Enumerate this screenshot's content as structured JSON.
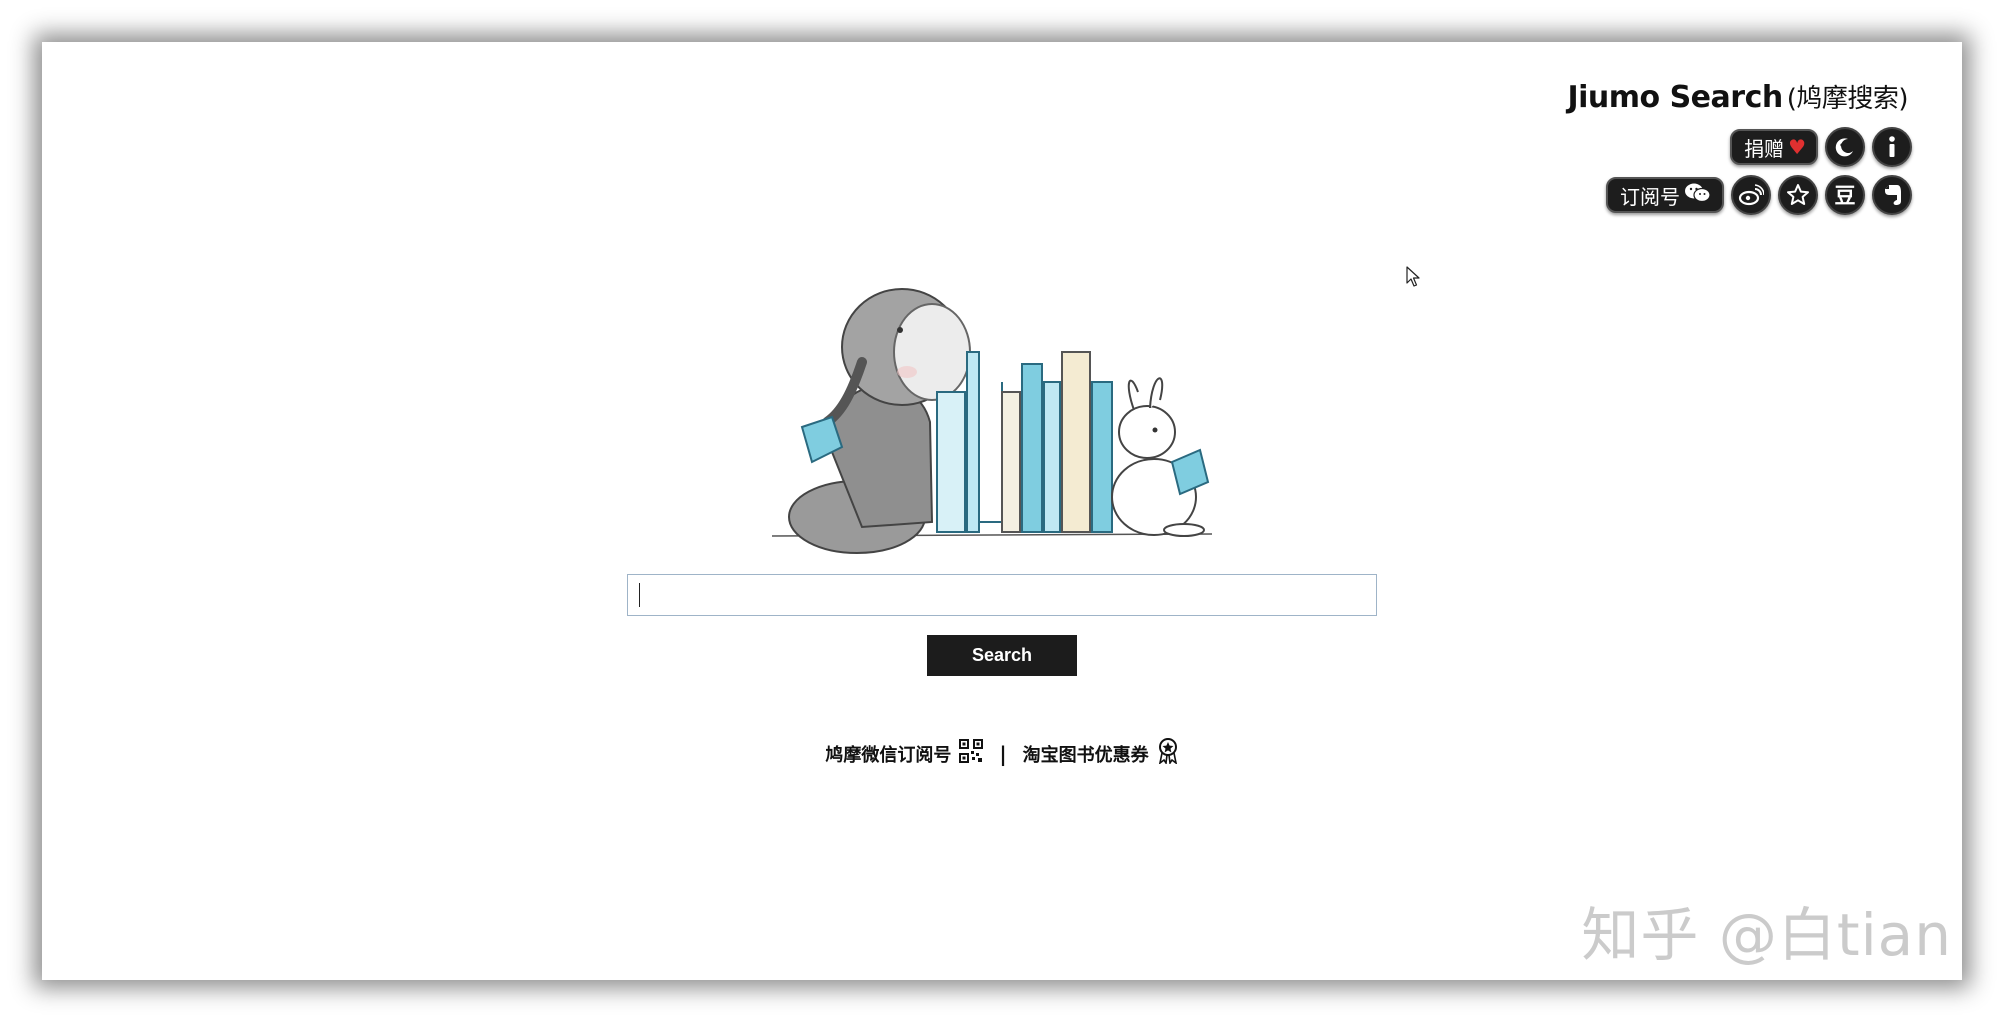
{
  "brand": {
    "title": "Jiumo Search",
    "subtitle": "(鸠摩搜索)"
  },
  "header_buttons": {
    "donate_label": "捐赠",
    "subscribe_label": "订阅号",
    "douban_label": "豆"
  },
  "search": {
    "placeholder": "",
    "value": "",
    "button_label": "Search"
  },
  "links": {
    "wechat_label": "鸠摩微信订阅号",
    "separator": "|",
    "taobao_label": "淘宝图书优惠券"
  },
  "watermark": "知乎 @白tian",
  "colors": {
    "button_bg": "#1c1c1c",
    "heart": "#e03030",
    "input_border": "#9fb4c8",
    "book_blue": "#7fcde0"
  },
  "icons": {
    "donate": "heart-icon",
    "night_mode": "moon-icon",
    "info": "info-icon",
    "subscribe": "wechat-icon",
    "weibo": "weibo-icon",
    "favorite": "star-icon",
    "douban": "douban-icon",
    "evernote": "evernote-icon",
    "wechat_qr": "qr-code-icon",
    "coupon": "badge-icon"
  }
}
